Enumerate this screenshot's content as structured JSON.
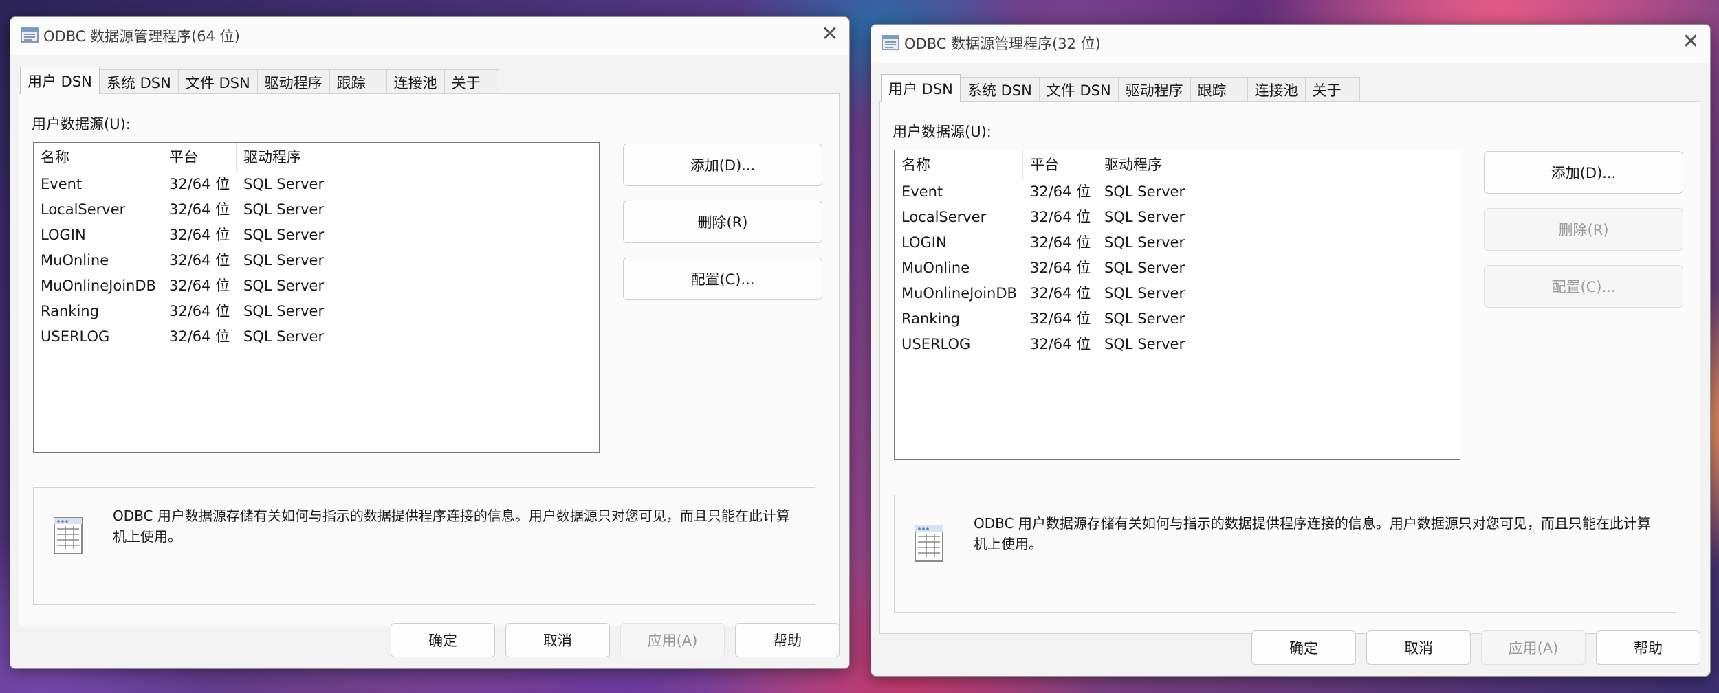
{
  "windows": [
    {
      "title": "ODBC 数据源管理程序(64 位)",
      "tabs": [
        "用户 DSN",
        "系统 DSN",
        "文件 DSN",
        "驱动程序",
        "跟踪",
        "连接池",
        "关于"
      ],
      "active_tab": "用户 DSN",
      "list_label": "用户数据源(U):",
      "columns": [
        "名称",
        "平台",
        "驱动程序"
      ],
      "rows": [
        {
          "name": "Event",
          "platform": "32/64 位",
          "driver": "SQL Server"
        },
        {
          "name": "LocalServer",
          "platform": "32/64 位",
          "driver": "SQL Server"
        },
        {
          "name": "LOGIN",
          "platform": "32/64 位",
          "driver": "SQL Server"
        },
        {
          "name": "MuOnline",
          "platform": "32/64 位",
          "driver": "SQL Server"
        },
        {
          "name": "MuOnlineJoinDB",
          "platform": "32/64 位",
          "driver": "SQL Server"
        },
        {
          "name": "Ranking",
          "platform": "32/64 位",
          "driver": "SQL Server"
        },
        {
          "name": "USERLOG",
          "platform": "32/64 位",
          "driver": "SQL Server"
        }
      ],
      "buttons": {
        "add": "添加(D)...",
        "remove": "删除(R)",
        "configure": "配置(C)..."
      },
      "info_text": "ODBC 用户数据源存储有关如何与指示的数据提供程序连接的信息。用户数据源只对您可见，而且只能在此计算机上使用。",
      "footer": {
        "ok": "确定",
        "cancel": "取消",
        "apply": "应用(A)",
        "help": "帮助"
      }
    },
    {
      "title": "ODBC 数据源管理程序(32 位)",
      "tabs": [
        "用户 DSN",
        "系统 DSN",
        "文件 DSN",
        "驱动程序",
        "跟踪",
        "连接池",
        "关于"
      ],
      "active_tab": "用户 DSN",
      "list_label": "用户数据源(U):",
      "columns": [
        "名称",
        "平台",
        "驱动程序"
      ],
      "rows": [
        {
          "name": "Event",
          "platform": "32/64 位",
          "driver": "SQL Server"
        },
        {
          "name": "LocalServer",
          "platform": "32/64 位",
          "driver": "SQL Server"
        },
        {
          "name": "LOGIN",
          "platform": "32/64 位",
          "driver": "SQL Server"
        },
        {
          "name": "MuOnline",
          "platform": "32/64 位",
          "driver": "SQL Server"
        },
        {
          "name": "MuOnlineJoinDB",
          "platform": "32/64 位",
          "driver": "SQL Server"
        },
        {
          "name": "Ranking",
          "platform": "32/64 位",
          "driver": "SQL Server"
        },
        {
          "name": "USERLOG",
          "platform": "32/64 位",
          "driver": "SQL Server"
        }
      ],
      "buttons": {
        "add": "添加(D)...",
        "remove": "删除(R)",
        "configure": "配置(C)..."
      },
      "info_text": "ODBC 用户数据源存储有关如何与指示的数据提供程序连接的信息。用户数据源只对您可见，而且只能在此计算机上使用。",
      "footer": {
        "ok": "确定",
        "cancel": "取消",
        "apply": "应用(A)",
        "help": "帮助"
      }
    }
  ],
  "icons": {
    "app": "odbc-app-icon",
    "close": "close-icon",
    "info": "data-table-icon"
  }
}
